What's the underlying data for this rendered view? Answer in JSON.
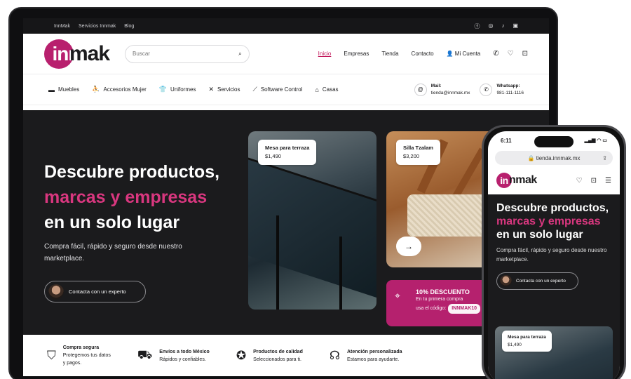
{
  "topbar": {
    "links": [
      "InnMak",
      "Servicios Innmak",
      "Blog"
    ],
    "social_icons": [
      "facebook-icon",
      "instagram-icon",
      "tiktok-icon",
      "linkedin-icon"
    ]
  },
  "header": {
    "logo_text": "innmak",
    "search_placeholder": "Buscar",
    "nav": [
      "Inicio",
      "Empresas",
      "Tienda",
      "Contacto"
    ],
    "account": "Mi Cuenta"
  },
  "categories": [
    "Muebles",
    "Accesorios Mujer",
    "Uniformes",
    "Servicios",
    "Software Control",
    "Casas"
  ],
  "contact": {
    "mail_label": "Mail:",
    "mail_value": "tienda@innmak.mx",
    "whatsapp_label": "Whatsapp:",
    "whatsapp_value": "981-111-1116"
  },
  "hero": {
    "line1": "Descubre productos,",
    "line2": "marcas y empresas",
    "line3": "en un solo lugar",
    "subtitle": "Compra fácil, rápido y seguro desde nuestro marketplace.",
    "cta": "Contacta con un experto"
  },
  "products": [
    {
      "name": "Mesa para terraza",
      "price": "$1,490"
    },
    {
      "name": "Silla Tzalam",
      "price": "$3,200"
    }
  ],
  "promo": {
    "title": "10% DESCUENTO",
    "line1": "En tu primera compra",
    "line2": "usa el código:",
    "code": "INNMAK10"
  },
  "features": [
    {
      "title": "Compra segura",
      "line1": "Protegemos tus datos",
      "line2": "y pagos.",
      "icon": "shield-icon"
    },
    {
      "title": "Envíos a todo México",
      "line1": "Rápidos y confiables.",
      "line2": "",
      "icon": "truck-icon"
    },
    {
      "title": "Productos de calidad",
      "line1": "Seleccionados para ti.",
      "line2": "",
      "icon": "award-icon"
    },
    {
      "title": "Atención personalizada",
      "line1": "Estamos para ayudarte.",
      "line2": "",
      "icon": "headset-icon"
    }
  ],
  "phone": {
    "time": "6:11",
    "url": "tienda.innmak.mx",
    "logo_text": "innmak",
    "line1": "Descubre productos,",
    "line2": "marcas y empresas",
    "line3": "en un solo lugar",
    "subtitle": "Compra fácil, rápido y seguro desde nuestro marketplace.",
    "cta": "Contacta con un experto",
    "product_name": "Mesa para terraza",
    "product_price": "$1,490"
  },
  "colors": {
    "brand": "#b8206e",
    "accent_text": "#d9377f",
    "hero_bg": "#1b1b1d"
  }
}
